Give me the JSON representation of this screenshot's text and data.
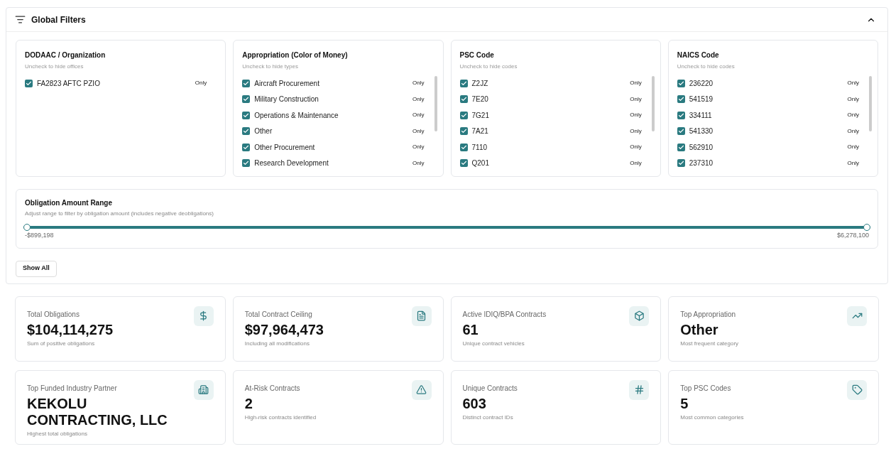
{
  "filters_panel": {
    "title": "Global Filters",
    "expanded": true,
    "groups": [
      {
        "title": "DODAAC / Organization",
        "hint": "Uncheck to hide offices",
        "items": [
          {
            "label": "FA2823 AFTC PZIO",
            "checked": true,
            "action": "Only"
          }
        ]
      },
      {
        "title": "Appropriation (Color of Money)",
        "hint": "Uncheck to hide types",
        "items": [
          {
            "label": "Aircraft Procurement",
            "checked": true,
            "action": "Only"
          },
          {
            "label": "Military Construction",
            "checked": true,
            "action": "Only"
          },
          {
            "label": "Operations & Maintenance",
            "checked": true,
            "action": "Only"
          },
          {
            "label": "Other",
            "checked": true,
            "action": "Only"
          },
          {
            "label": "Other Procurement",
            "checked": true,
            "action": "Only"
          },
          {
            "label": "Research Development",
            "checked": true,
            "action": "Only"
          }
        ]
      },
      {
        "title": "PSC Code",
        "hint": "Uncheck to hide codes",
        "items": [
          {
            "label": "Z2JZ",
            "checked": true,
            "action": "Only"
          },
          {
            "label": "7E20",
            "checked": true,
            "action": "Only"
          },
          {
            "label": "7G21",
            "checked": true,
            "action": "Only"
          },
          {
            "label": "7A21",
            "checked": true,
            "action": "Only"
          },
          {
            "label": "7110",
            "checked": true,
            "action": "Only"
          },
          {
            "label": "Q201",
            "checked": true,
            "action": "Only"
          }
        ]
      },
      {
        "title": "NAICS Code",
        "hint": "Uncheck to hide codes",
        "items": [
          {
            "label": "236220",
            "checked": true,
            "action": "Only"
          },
          {
            "label": "541519",
            "checked": true,
            "action": "Only"
          },
          {
            "label": "334111",
            "checked": true,
            "action": "Only"
          },
          {
            "label": "541330",
            "checked": true,
            "action": "Only"
          },
          {
            "label": "562910",
            "checked": true,
            "action": "Only"
          },
          {
            "label": "237310",
            "checked": true,
            "action": "Only"
          }
        ]
      }
    ],
    "range": {
      "title": "Obligation Amount Range",
      "hint": "Adjust range to filter by obligation amount (includes negative deobligations)",
      "min_label": "-$899,198",
      "max_label": "$6,278,100"
    },
    "show_all_button": "Show All"
  },
  "stats": [
    {
      "title": "Total Obligations",
      "value": "$104,114,275",
      "note": "Sum of positive obligations"
    },
    {
      "title": "Total Contract Ceiling",
      "value": "$97,964,473",
      "note": "Including all modifications"
    },
    {
      "title": "Active IDIQ/BPA Contracts",
      "value": "61",
      "note": "Unique contract vehicles"
    },
    {
      "title": "Top Appropriation",
      "value": "Other",
      "note": "Most frequent category"
    },
    {
      "title": "Top Funded Industry Partner",
      "value": "KEKOLU CONTRACTING, LLC",
      "note": "Highest total obligations"
    },
    {
      "title": "At-Risk Contracts",
      "value": "2",
      "note": "High-risk contracts identified"
    },
    {
      "title": "Unique Contracts",
      "value": "603",
      "note": "Distinct contract IDs"
    },
    {
      "title": "Top PSC Codes",
      "value": "5",
      "note": "Most common categories"
    }
  ]
}
